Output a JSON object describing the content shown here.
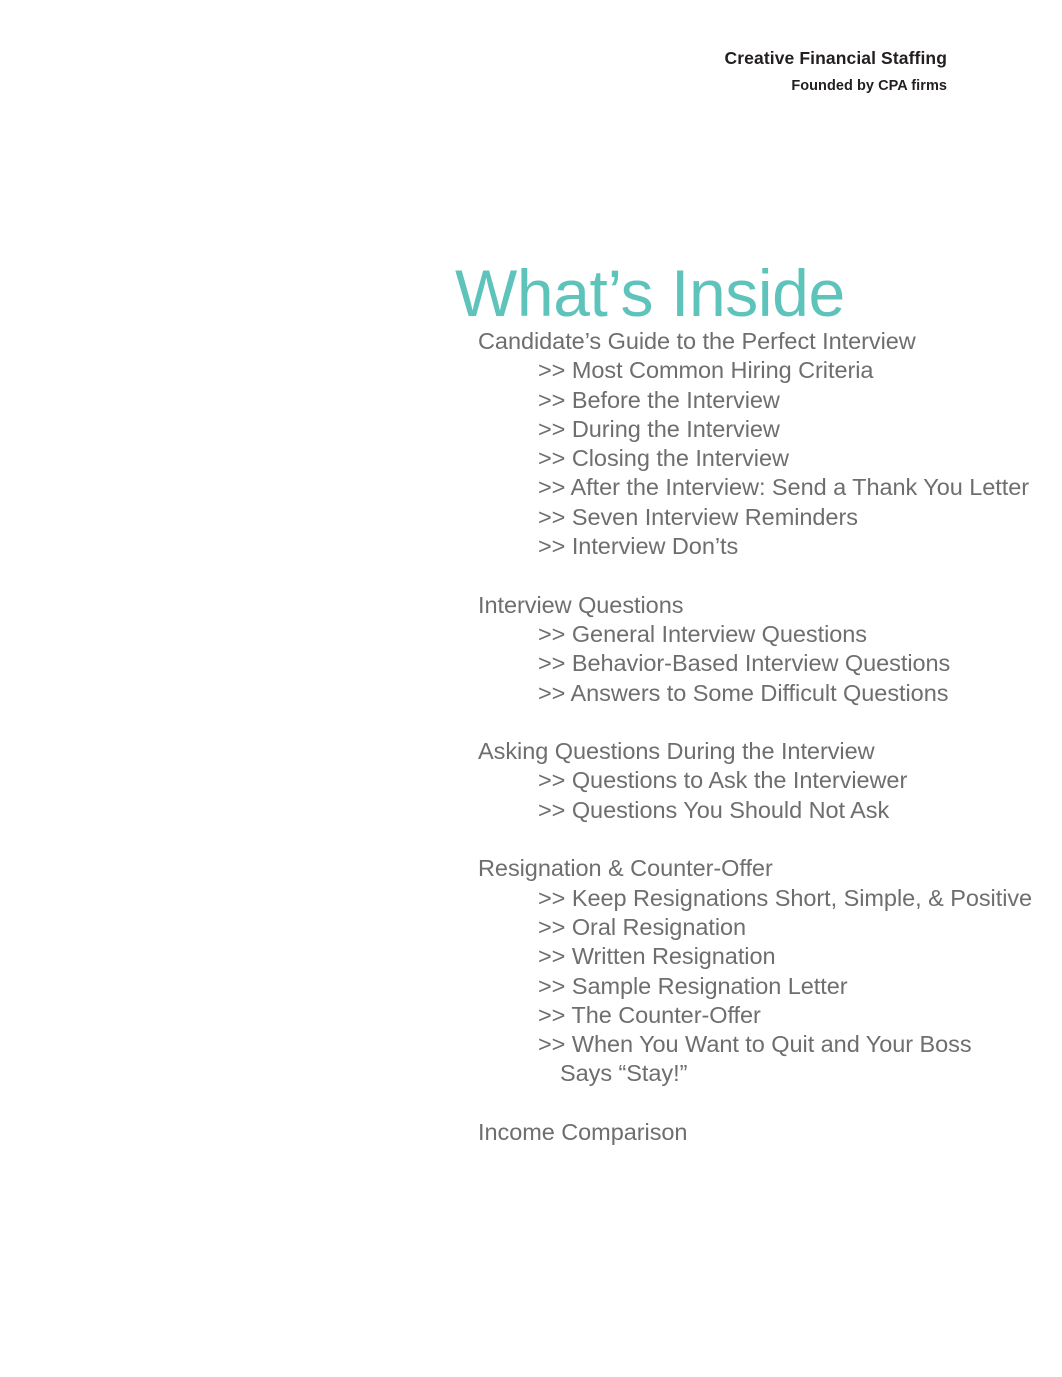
{
  "letterhead": {
    "company": "Creative Financial Staffing",
    "tagline": "Founded by CPA firms"
  },
  "title": "What’s Inside",
  "colors": {
    "title_teal": "#5ec3bb",
    "body_gray": "#6e6e6e",
    "letterhead_black": "#231f20",
    "page_background": "#ffffff"
  },
  "toc": {
    "bullet_marker": ">>",
    "sections": [
      {
        "heading": "Candidate’s Guide to the Perfect Interview",
        "entries": [
          ">> Most Common Hiring Criteria",
          ">> Before the Interview",
          ">> During the Interview",
          ">> Closing the Interview",
          ">> After the Interview: Send a Thank You Letter",
          ">> Seven Interview Reminders",
          ">> Interview Don’ts"
        ]
      },
      {
        "heading": "Interview Questions",
        "entries": [
          ">> General Interview Questions",
          ">> Behavior-Based Interview Questions",
          ">> Answers to Some Difficult Questions"
        ]
      },
      {
        "heading": "Asking Questions During the Interview",
        "entries": [
          ">> Questions to Ask the Interviewer",
          ">> Questions You Should Not Ask"
        ]
      },
      {
        "heading": "Resignation & Counter-Offer",
        "entries": [
          ">> Keep Resignations Short, Simple, & Positive",
          ">> Oral Resignation",
          ">> Written Resignation",
          ">> Sample Resignation Letter",
          ">> The Counter-Offer",
          ">> When You Want to Quit and Your Boss"
        ],
        "continuation": "Says “Stay!”"
      },
      {
        "heading": "Income Comparison",
        "entries": []
      }
    ]
  }
}
